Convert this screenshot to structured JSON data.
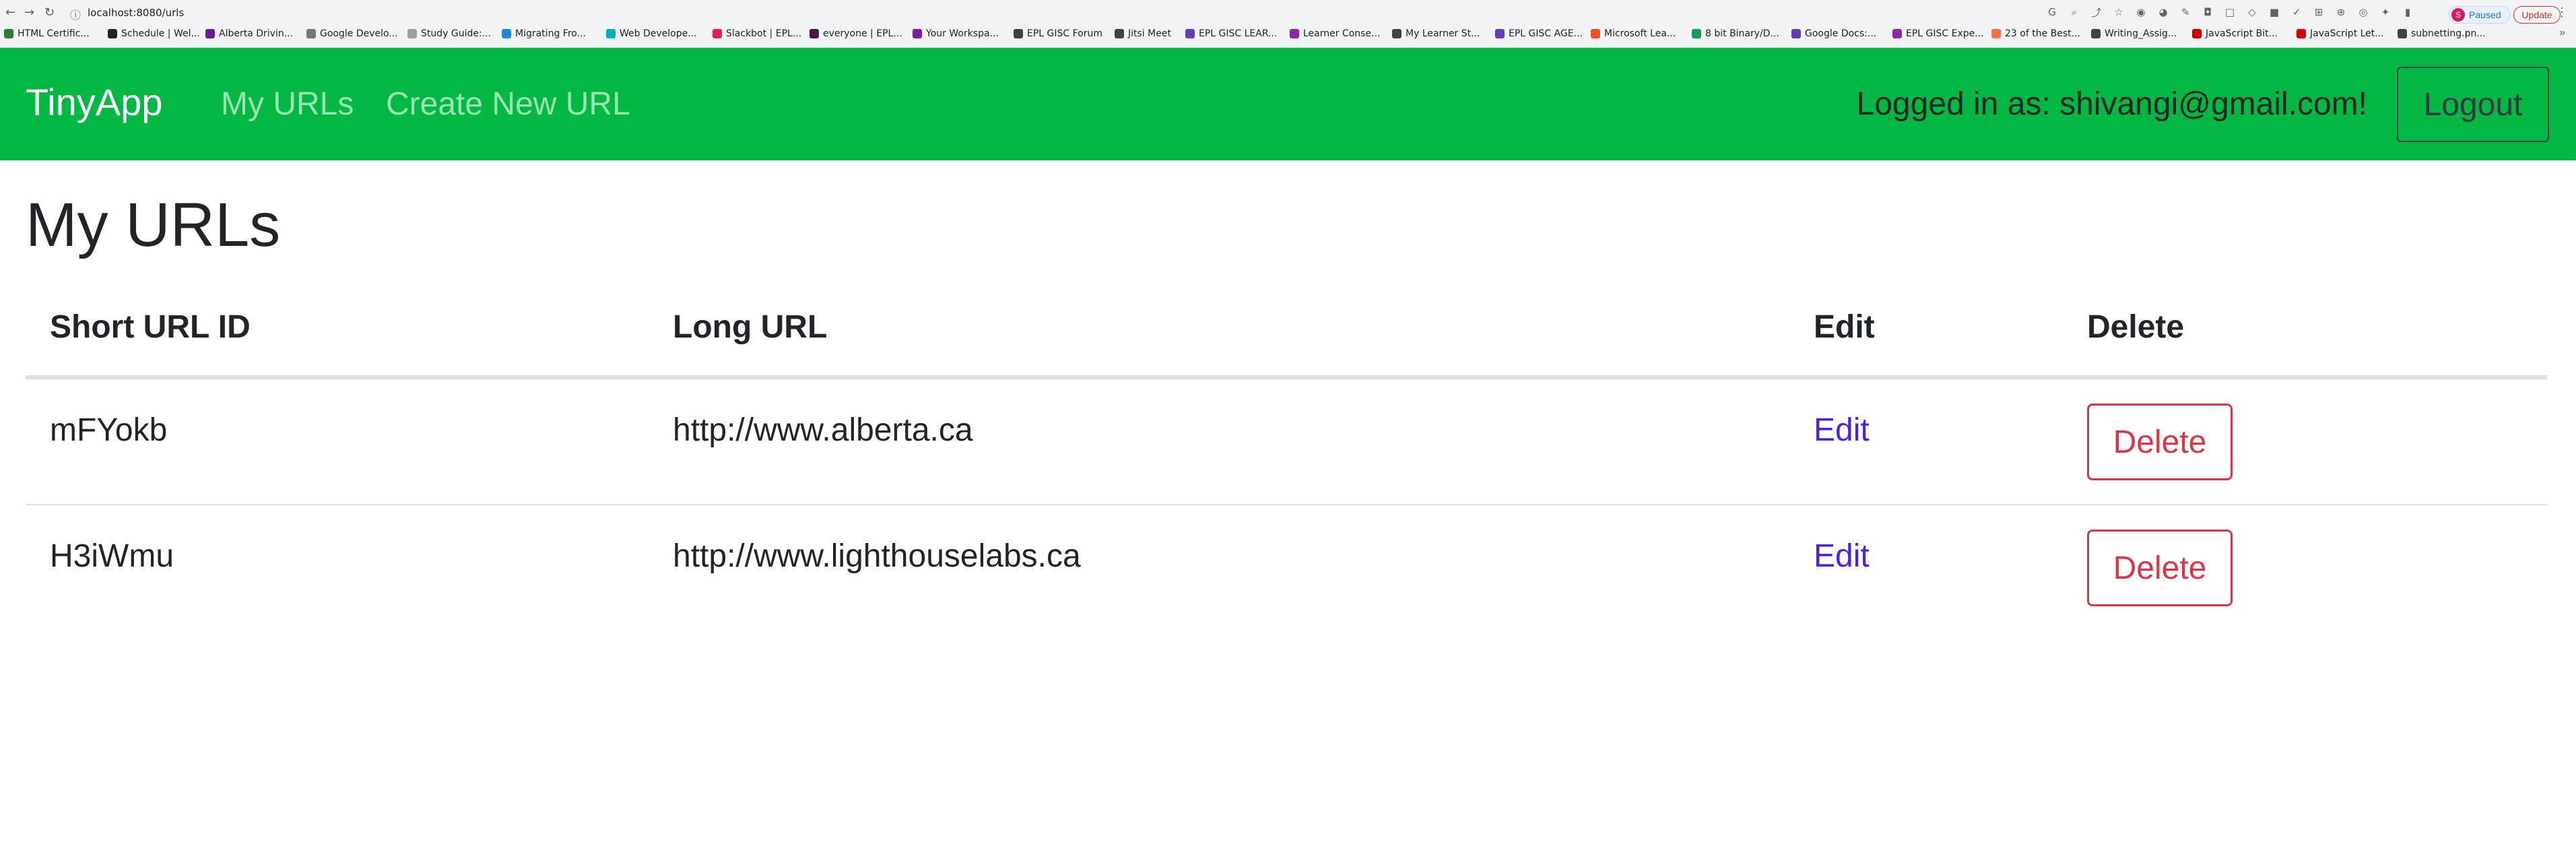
{
  "browser": {
    "address": "localhost:8080/urls",
    "profile_initial": "S",
    "profile_label": "Paused",
    "update_label": "Update",
    "bookmarks": [
      {
        "label": "HTML Certific...",
        "color": "#2e7d32"
      },
      {
        "label": "Schedule | Wel...",
        "color": "#212121"
      },
      {
        "label": "Alberta Drivin...",
        "color": "#6a1b9a"
      },
      {
        "label": "Google Develo...",
        "color": "#757575"
      },
      {
        "label": "Study Guide:...",
        "color": "#9e9e9e"
      },
      {
        "label": "Migrating Fro...",
        "color": "#1e88e5"
      },
      {
        "label": "Web Develope...",
        "color": "#00acc1"
      },
      {
        "label": "Slackbot | EPL...",
        "color": "#e01e5a"
      },
      {
        "label": "everyone | EPL...",
        "color": "#4a154b"
      },
      {
        "label": "Your Workspa...",
        "color": "#7b1fa2"
      },
      {
        "label": "EPL GISC Forum",
        "color": "#424242"
      },
      {
        "label": "Jitsi Meet",
        "color": "#424242"
      },
      {
        "label": "EPL GISC LEAR...",
        "color": "#673ab7"
      },
      {
        "label": "Learner Conse...",
        "color": "#8e24aa"
      },
      {
        "label": "My Learner St...",
        "color": "#424242"
      },
      {
        "label": "EPL GISC AGE...",
        "color": "#673ab7"
      },
      {
        "label": "Microsoft Lea...",
        "color": "#f25022"
      },
      {
        "label": "8 bit Binary/D...",
        "color": "#0f9d58"
      },
      {
        "label": "Google Docs:...",
        "color": "#673ab7"
      },
      {
        "label": "EPL GISC Expe...",
        "color": "#8e24aa"
      },
      {
        "label": "23 of the Best...",
        "color": "#ff7043"
      },
      {
        "label": "Writing_Assig...",
        "color": "#424242"
      },
      {
        "label": "JavaScript Bit...",
        "color": "#d50000"
      },
      {
        "label": "JavaScript Let...",
        "color": "#d50000"
      },
      {
        "label": "subnetting.pn...",
        "color": "#424242"
      }
    ]
  },
  "navbar": {
    "brand": "TinyApp",
    "links": [
      "My URLs",
      "Create New URL"
    ],
    "logged_in_text": "Logged in as: shivangi@gmail.com!",
    "logout_label": "Logout",
    "bg_color": "#02b843"
  },
  "main": {
    "title": "My URLs",
    "columns": [
      "Short URL ID",
      "Long URL",
      "Edit",
      "Delete"
    ],
    "rows": [
      {
        "short_id": "mFYokb",
        "long_url": "http://www.alberta.ca",
        "edit_label": "Edit",
        "delete_label": "Delete"
      },
      {
        "short_id": "H3iWmu",
        "long_url": "http://www.lighthouselabs.ca",
        "edit_label": "Edit",
        "delete_label": "Delete"
      }
    ],
    "edit_color": "#4f1fe6",
    "delete_color": "#dc3545"
  }
}
